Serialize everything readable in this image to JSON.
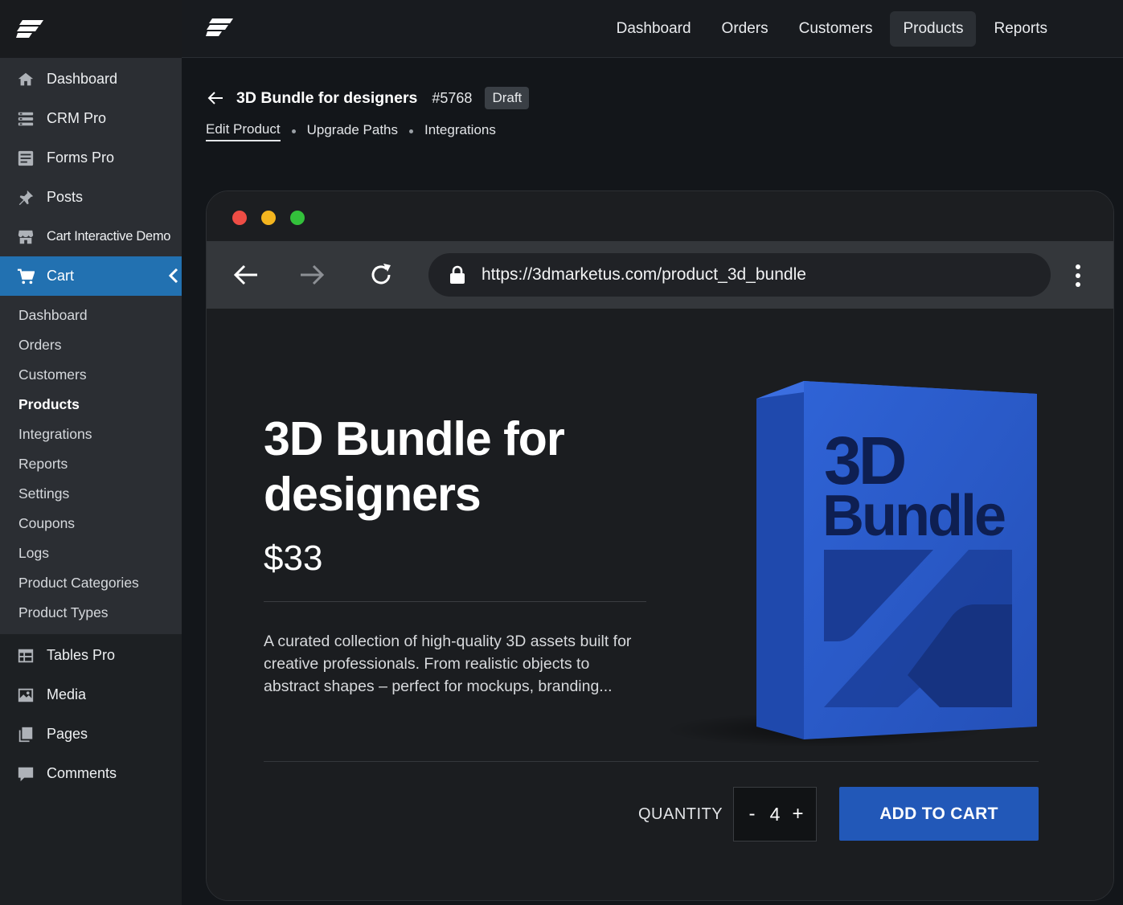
{
  "sidebar": {
    "top_items": [
      {
        "label": "Dashboard",
        "icon": "dashboard-icon"
      },
      {
        "label": "CRM Pro",
        "icon": "crm-icon"
      },
      {
        "label": "Forms Pro",
        "icon": "forms-icon"
      },
      {
        "label": "Posts",
        "icon": "pin-icon"
      },
      {
        "label": "Cart Interactive Demo",
        "icon": "store-icon"
      },
      {
        "label": "Cart",
        "icon": "cart-icon"
      }
    ],
    "submenu": [
      "Dashboard",
      "Orders",
      "Customers",
      "Products",
      "Integrations",
      "Reports",
      "Settings",
      "Coupons",
      "Logs",
      "Product Categories",
      "Product Types"
    ],
    "bottom_items": [
      {
        "label": "Tables Pro",
        "icon": "table-icon"
      },
      {
        "label": "Media",
        "icon": "media-icon"
      },
      {
        "label": "Pages",
        "icon": "pages-icon"
      },
      {
        "label": "Comments",
        "icon": "comment-icon"
      }
    ]
  },
  "topnav": [
    "Dashboard",
    "Orders",
    "Customers",
    "Products",
    "Reports"
  ],
  "page": {
    "title": "3D Bundle for designers",
    "id": "#5768",
    "status": "Draft",
    "tabs": [
      "Edit Product",
      "Upgrade Paths",
      "Integrations"
    ]
  },
  "browser": {
    "url": "https://3dmarketus.com/product_3d_bundle"
  },
  "product": {
    "title": "3D Bundle for designers",
    "price": "$33",
    "description": "A curated collection of high-quality 3D assets built for creative professionals. From realistic objects to abstract shapes – perfect for mockups, branding...",
    "box_line1": "3D",
    "box_line2": "Bundle",
    "quantity_label": "QUANTITY",
    "quantity": "4",
    "minus": "-",
    "plus": "+",
    "add_to_cart": "ADD TO CART"
  },
  "colors": {
    "accent": "#2271b1",
    "button": "#2258b8",
    "box_blue": "#2d5fd0"
  }
}
